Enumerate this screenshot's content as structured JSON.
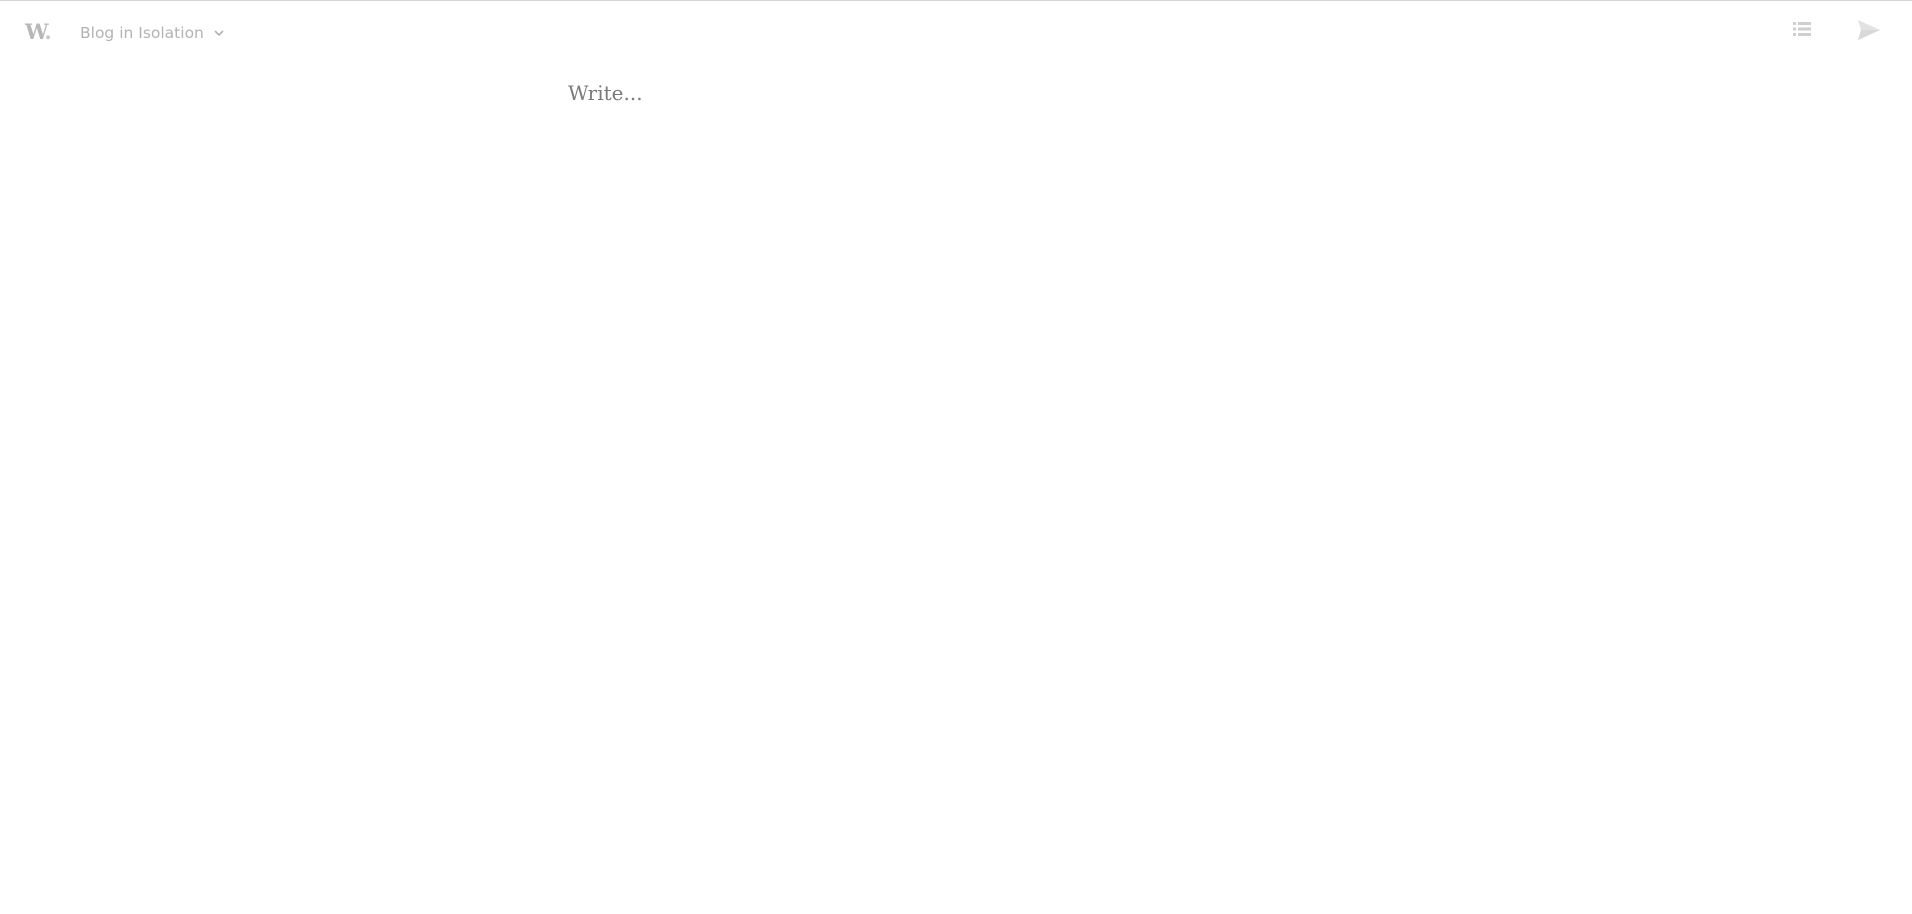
{
  "header": {
    "logo_text": "W",
    "logo_dot": ".",
    "blog_name": "Blog in Isolation"
  },
  "toolbar": {
    "posts_icon": "list-icon",
    "publish_icon": "send-icon"
  },
  "editor": {
    "placeholder": "Write..."
  },
  "colors": {
    "icon": "#d6d6d6",
    "muted_text": "#b3b3b3",
    "placeholder": "#7a7a7a"
  }
}
